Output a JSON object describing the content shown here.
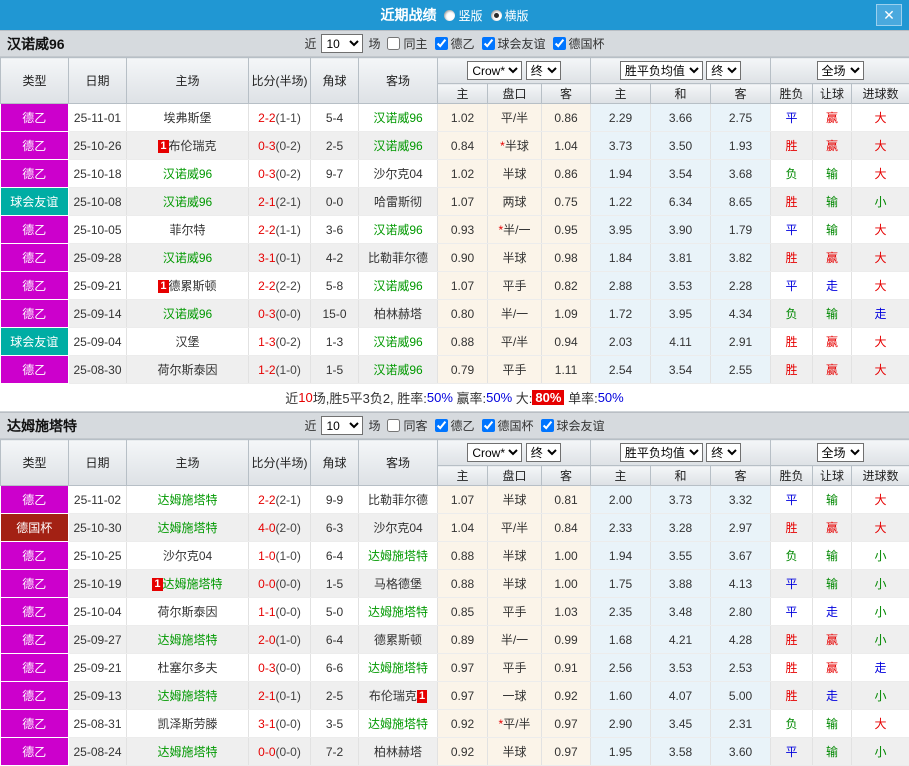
{
  "titlebar": {
    "title": "近期战绩",
    "radio_vertical": "竖版",
    "radio_horizontal": "横版",
    "close": "✕",
    "bar_color": "#2097d3"
  },
  "columns": {
    "type": "类型",
    "date": "日期",
    "home": "主场",
    "score": "比分(半场)",
    "corner": "角球",
    "away": "客场",
    "odds_home": "主",
    "handicap": "盘口",
    "odds_away": "客",
    "avg_home": "主",
    "avg_draw": "和",
    "avg_away": "客",
    "result": "胜负",
    "let_goal": "让球",
    "goals": "进球数"
  },
  "selects": {
    "crow": "Crow*",
    "final": "终",
    "avg": "胜平负均值",
    "full": "全场"
  },
  "league_colors": {
    "德乙": "#cc00cc",
    "球会友谊": "#00ada4",
    "德国杯": "#a32114"
  },
  "value_colors": {
    "胜": "#e60000",
    "平": "#0000dd",
    "负": "#008800",
    "赢": "#e60000",
    "走": "#0000dd",
    "输": "#008800",
    "大": "#e60000",
    "小": "#008800"
  },
  "tables": [
    {
      "team": "汉诺威96",
      "filter": {
        "near": "近",
        "count": "10",
        "games": "场",
        "same": "同主",
        "same_checked": false,
        "leagues": [
          "德乙",
          "球会友谊",
          "德国杯"
        ]
      },
      "rows": [
        {
          "league": "德乙",
          "date": "25-11-01",
          "home": "埃弗斯堡",
          "home_green": false,
          "home_badge": "",
          "score": "2-2",
          "half": "(1-1)",
          "corner": "5-4",
          "away": "汉诺威96",
          "away_green": true,
          "away_badge": "",
          "o_home": "1.02",
          "handicap": "平/半",
          "star": false,
          "o_away": "0.86",
          "avg_home": "2.29",
          "avg_draw": "3.66",
          "avg_away": "2.75",
          "result": "平",
          "let": "赢",
          "goals": "大"
        },
        {
          "league": "德乙",
          "date": "25-10-26",
          "home": "布伦瑞克",
          "home_green": false,
          "home_badge": "pre",
          "score": "0-3",
          "half": "(0-2)",
          "corner": "2-5",
          "away": "汉诺威96",
          "away_green": true,
          "away_badge": "",
          "o_home": "0.84",
          "handicap": "半球",
          "star": true,
          "o_away": "1.04",
          "avg_home": "3.73",
          "avg_draw": "3.50",
          "avg_away": "1.93",
          "result": "胜",
          "let": "赢",
          "goals": "大"
        },
        {
          "league": "德乙",
          "date": "25-10-18",
          "home": "汉诺威96",
          "home_green": true,
          "home_badge": "",
          "score": "0-3",
          "half": "(0-2)",
          "corner": "9-7",
          "away": "沙尔克04",
          "away_green": false,
          "away_badge": "",
          "o_home": "1.02",
          "handicap": "半球",
          "star": false,
          "o_away": "0.86",
          "avg_home": "1.94",
          "avg_draw": "3.54",
          "avg_away": "3.68",
          "result": "负",
          "let": "输",
          "goals": "大"
        },
        {
          "league": "球会友谊",
          "date": "25-10-08",
          "home": "汉诺威96",
          "home_green": true,
          "home_badge": "",
          "score": "2-1",
          "half": "(2-1)",
          "corner": "0-0",
          "away": "哈雷斯彻",
          "away_green": false,
          "away_badge": "",
          "o_home": "1.07",
          "handicap": "两球",
          "star": false,
          "o_away": "0.75",
          "avg_home": "1.22",
          "avg_draw": "6.34",
          "avg_away": "8.65",
          "result": "胜",
          "let": "输",
          "goals": "小"
        },
        {
          "league": "德乙",
          "date": "25-10-05",
          "home": "菲尔特",
          "home_green": false,
          "home_badge": "",
          "score": "2-2",
          "half": "(1-1)",
          "corner": "3-6",
          "away": "汉诺威96",
          "away_green": true,
          "away_badge": "",
          "o_home": "0.93",
          "handicap": "半/一",
          "star": true,
          "o_away": "0.95",
          "avg_home": "3.95",
          "avg_draw": "3.90",
          "avg_away": "1.79",
          "result": "平",
          "let": "输",
          "goals": "大"
        },
        {
          "league": "德乙",
          "date": "25-09-28",
          "home": "汉诺威96",
          "home_green": true,
          "home_badge": "",
          "score": "3-1",
          "half": "(0-1)",
          "corner": "4-2",
          "away": "比勒菲尔德",
          "away_green": false,
          "away_badge": "",
          "o_home": "0.90",
          "handicap": "半球",
          "star": false,
          "o_away": "0.98",
          "avg_home": "1.84",
          "avg_draw": "3.81",
          "avg_away": "3.82",
          "result": "胜",
          "let": "赢",
          "goals": "大"
        },
        {
          "league": "德乙",
          "date": "25-09-21",
          "home": "德累斯顿",
          "home_green": false,
          "home_badge": "pre",
          "score": "2-2",
          "half": "(2-2)",
          "corner": "5-8",
          "away": "汉诺威96",
          "away_green": true,
          "away_badge": "",
          "o_home": "1.07",
          "handicap": "平手",
          "star": false,
          "o_away": "0.82",
          "avg_home": "2.88",
          "avg_draw": "3.53",
          "avg_away": "2.28",
          "result": "平",
          "let": "走",
          "goals": "大"
        },
        {
          "league": "德乙",
          "date": "25-09-14",
          "home": "汉诺威96",
          "home_green": true,
          "home_badge": "",
          "score": "0-3",
          "half": "(0-0)",
          "corner": "15-0",
          "away": "柏林赫塔",
          "away_green": false,
          "away_badge": "",
          "o_home": "0.80",
          "handicap": "半/一",
          "star": false,
          "o_away": "1.09",
          "avg_home": "1.72",
          "avg_draw": "3.95",
          "avg_away": "4.34",
          "result": "负",
          "let": "输",
          "goals": "走"
        },
        {
          "league": "球会友谊",
          "date": "25-09-04",
          "home": "汉堡",
          "home_green": false,
          "home_badge": "",
          "score": "1-3",
          "half": "(0-2)",
          "corner": "1-3",
          "away": "汉诺威96",
          "away_green": true,
          "away_badge": "",
          "o_home": "0.88",
          "handicap": "平/半",
          "star": false,
          "o_away": "0.94",
          "avg_home": "2.03",
          "avg_draw": "4.11",
          "avg_away": "2.91",
          "result": "胜",
          "let": "赢",
          "goals": "大"
        },
        {
          "league": "德乙",
          "date": "25-08-30",
          "home": "荷尔斯泰因",
          "home_green": false,
          "home_badge": "",
          "score": "1-2",
          "half": "(1-0)",
          "corner": "1-5",
          "away": "汉诺威96",
          "away_green": true,
          "away_badge": "",
          "o_home": "0.79",
          "handicap": "平手",
          "star": false,
          "o_away": "1.11",
          "avg_home": "2.54",
          "avg_draw": "3.54",
          "avg_away": "2.55",
          "result": "胜",
          "let": "赢",
          "goals": "大"
        }
      ],
      "summary": [
        {
          "text": "近"
        },
        {
          "text": "10",
          "cls": "sum-red"
        },
        {
          "text": "场,胜5平3负2, 胜率:"
        },
        {
          "text": "50%",
          "cls": "sum-blue"
        },
        {
          "text": " 赢率:"
        },
        {
          "text": "50%",
          "cls": "sum-blue"
        },
        {
          "text": " 大:"
        },
        {
          "text": "80%",
          "cls": "sum-badge"
        },
        {
          "text": " 单率:"
        },
        {
          "text": "50%",
          "cls": "sum-blue"
        }
      ]
    },
    {
      "team": "达姆施塔特",
      "filter": {
        "near": "近",
        "count": "10",
        "games": "场",
        "same": "同客",
        "same_checked": false,
        "leagues": [
          "德乙",
          "德国杯",
          "球会友谊"
        ]
      },
      "rows": [
        {
          "league": "德乙",
          "date": "25-11-02",
          "home": "达姆施塔特",
          "home_green": true,
          "home_badge": "",
          "score": "2-2",
          "half": "(2-1)",
          "corner": "9-9",
          "away": "比勒菲尔德",
          "away_green": false,
          "away_badge": "",
          "o_home": "1.07",
          "handicap": "半球",
          "star": false,
          "o_away": "0.81",
          "avg_home": "2.00",
          "avg_draw": "3.73",
          "avg_away": "3.32",
          "result": "平",
          "let": "输",
          "goals": "大"
        },
        {
          "league": "德国杯",
          "date": "25-10-30",
          "home": "达姆施塔特",
          "home_green": true,
          "home_badge": "",
          "score": "4-0",
          "half": "(2-0)",
          "corner": "6-3",
          "away": "沙尔克04",
          "away_green": false,
          "away_badge": "",
          "o_home": "1.04",
          "handicap": "平/半",
          "star": false,
          "o_away": "0.84",
          "avg_home": "2.33",
          "avg_draw": "3.28",
          "avg_away": "2.97",
          "result": "胜",
          "let": "赢",
          "goals": "大"
        },
        {
          "league": "德乙",
          "date": "25-10-25",
          "home": "沙尔克04",
          "home_green": false,
          "home_badge": "",
          "score": "1-0",
          "half": "(1-0)",
          "corner": "6-4",
          "away": "达姆施塔特",
          "away_green": true,
          "away_badge": "",
          "o_home": "0.88",
          "handicap": "半球",
          "star": false,
          "o_away": "1.00",
          "avg_home": "1.94",
          "avg_draw": "3.55",
          "avg_away": "3.67",
          "result": "负",
          "let": "输",
          "goals": "小"
        },
        {
          "league": "德乙",
          "date": "25-10-19",
          "home": "达姆施塔特",
          "home_green": true,
          "home_badge": "pre",
          "score": "0-0",
          "half": "(0-0)",
          "corner": "1-5",
          "away": "马格德堡",
          "away_green": false,
          "away_badge": "",
          "o_home": "0.88",
          "handicap": "半球",
          "star": false,
          "o_away": "1.00",
          "avg_home": "1.75",
          "avg_draw": "3.88",
          "avg_away": "4.13",
          "result": "平",
          "let": "输",
          "goals": "小"
        },
        {
          "league": "德乙",
          "date": "25-10-04",
          "home": "荷尔斯泰因",
          "home_green": false,
          "home_badge": "",
          "score": "1-1",
          "half": "(0-0)",
          "corner": "5-0",
          "away": "达姆施塔特",
          "away_green": true,
          "away_badge": "",
          "o_home": "0.85",
          "handicap": "平手",
          "star": false,
          "o_away": "1.03",
          "avg_home": "2.35",
          "avg_draw": "3.48",
          "avg_away": "2.80",
          "result": "平",
          "let": "走",
          "goals": "小"
        },
        {
          "league": "德乙",
          "date": "25-09-27",
          "home": "达姆施塔特",
          "home_green": true,
          "home_badge": "",
          "score": "2-0",
          "half": "(1-0)",
          "corner": "6-4",
          "away": "德累斯顿",
          "away_green": false,
          "away_badge": "",
          "o_home": "0.89",
          "handicap": "半/一",
          "star": false,
          "o_away": "0.99",
          "avg_home": "1.68",
          "avg_draw": "4.21",
          "avg_away": "4.28",
          "result": "胜",
          "let": "赢",
          "goals": "小"
        },
        {
          "league": "德乙",
          "date": "25-09-21",
          "home": "杜塞尔多夫",
          "home_green": false,
          "home_badge": "",
          "score": "0-3",
          "half": "(0-0)",
          "corner": "6-6",
          "away": "达姆施塔特",
          "away_green": true,
          "away_badge": "",
          "o_home": "0.97",
          "handicap": "平手",
          "star": false,
          "o_away": "0.91",
          "avg_home": "2.56",
          "avg_draw": "3.53",
          "avg_away": "2.53",
          "result": "胜",
          "let": "赢",
          "goals": "走"
        },
        {
          "league": "德乙",
          "date": "25-09-13",
          "home": "达姆施塔特",
          "home_green": true,
          "home_badge": "",
          "score": "2-1",
          "half": "(0-1)",
          "corner": "2-5",
          "away": "布伦瑞克",
          "away_green": false,
          "away_badge": "post",
          "o_home": "0.97",
          "handicap": "一球",
          "star": false,
          "o_away": "0.92",
          "avg_home": "1.60",
          "avg_draw": "4.07",
          "avg_away": "5.00",
          "result": "胜",
          "let": "走",
          "goals": "小"
        },
        {
          "league": "德乙",
          "date": "25-08-31",
          "home": "凯泽斯劳滕",
          "home_green": false,
          "home_badge": "",
          "score": "3-1",
          "half": "(0-0)",
          "corner": "3-5",
          "away": "达姆施塔特",
          "away_green": true,
          "away_badge": "",
          "o_home": "0.92",
          "handicap": "平/半",
          "star": true,
          "o_away": "0.97",
          "avg_home": "2.90",
          "avg_draw": "3.45",
          "avg_away": "2.31",
          "result": "负",
          "let": "输",
          "goals": "大"
        },
        {
          "league": "德乙",
          "date": "25-08-24",
          "home": "达姆施塔特",
          "home_green": true,
          "home_badge": "",
          "score": "0-0",
          "half": "(0-0)",
          "corner": "7-2",
          "away": "柏林赫塔",
          "away_green": false,
          "away_badge": "",
          "o_home": "0.92",
          "handicap": "半球",
          "star": false,
          "o_away": "0.97",
          "avg_home": "1.95",
          "avg_draw": "3.58",
          "avg_away": "3.60",
          "result": "平",
          "let": "输",
          "goals": "小"
        }
      ],
      "summary": null
    }
  ]
}
